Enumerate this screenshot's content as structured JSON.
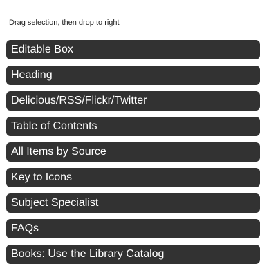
{
  "instruction": "Drag selection, then drop to right",
  "items": [
    {
      "label": "Editable Box"
    },
    {
      "label": "Heading"
    },
    {
      "label": "Delicious/RSS/Flickr/Twitter"
    },
    {
      "label": "Table of Contents"
    },
    {
      "label": "All Items by Source"
    },
    {
      "label": "Key to Icons"
    },
    {
      "label": "Subject Specialist"
    },
    {
      "label": "FAQs"
    },
    {
      "label": "Books: Use the Library Catalog"
    }
  ],
  "colors": {
    "item_background": "#323232",
    "item_text": "#ffffff",
    "divider": "#d9d9d9"
  }
}
